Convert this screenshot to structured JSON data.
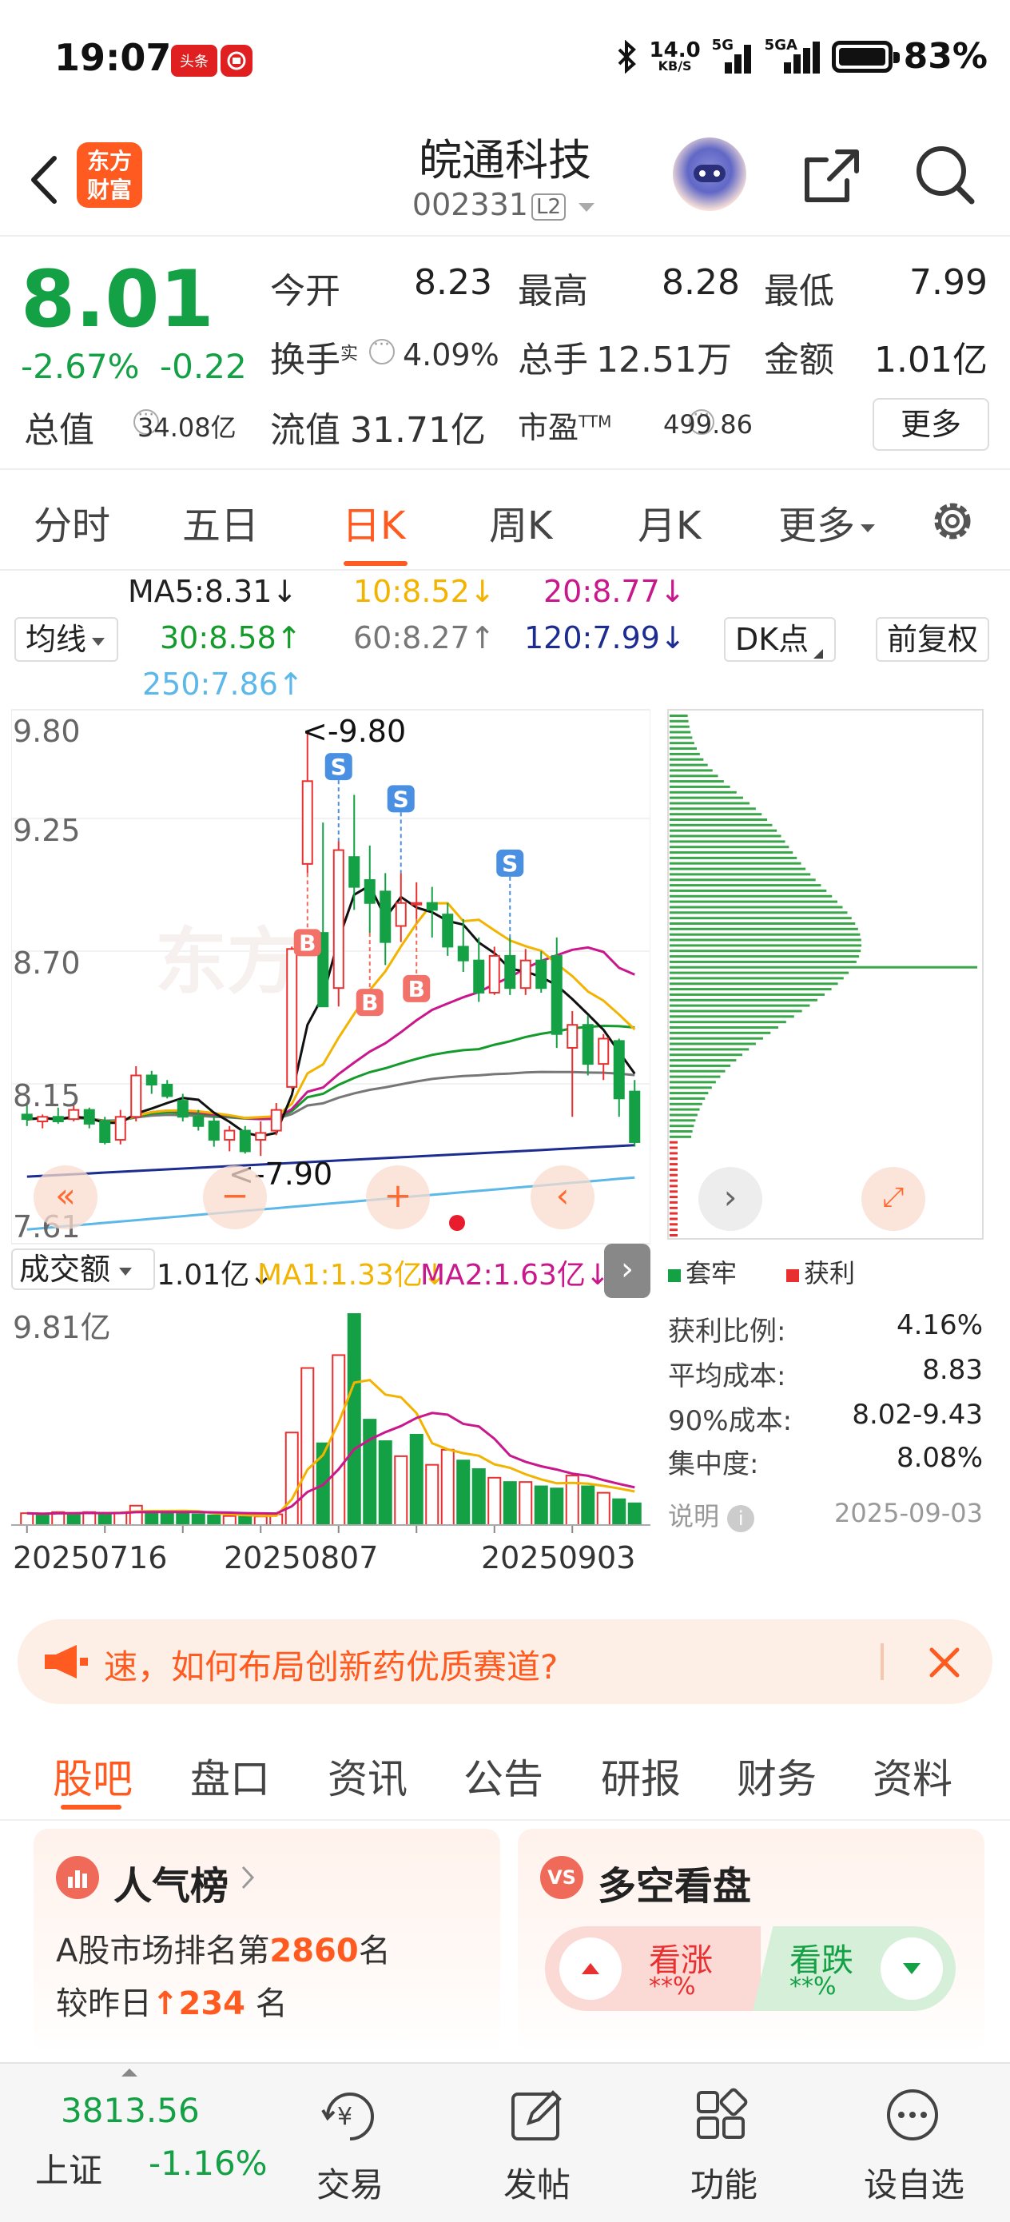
{
  "status_bar": {
    "time": "19:07",
    "badge1": "头条",
    "netspeed_value": "14.0",
    "netspeed_unit": "KB/S",
    "net1": "5G",
    "net2": "5GA",
    "battery": "83%"
  },
  "header": {
    "brand_line1": "东方",
    "brand_line2": "财富",
    "stock_name": "皖通科技",
    "stock_code": "002331",
    "level_badge": "L2"
  },
  "quote": {
    "last_price": "8.01",
    "change_pct": "-2.67%",
    "change_amt": "-0.22",
    "open_label": "今开",
    "open_value": "8.23",
    "high_label": "最高",
    "high_value": "8.28",
    "low_label": "最低",
    "low_value": "7.99",
    "turnover_label": "换手",
    "turnover_sup": "实",
    "turnover_value": "4.09%",
    "volume_label": "总手",
    "volume_value": "12.51万",
    "amount_label": "金额",
    "amount_value": "1.01亿",
    "mktcap_label": "总值",
    "mktcap_value": "34.08亿",
    "float_label": "流值",
    "float_value": "31.71亿",
    "pe_label": "市盈",
    "pe_sup": "TTM",
    "pe_value": "499.86",
    "more_label": "更多"
  },
  "period_tabs": [
    "分时",
    "五日",
    "日K",
    "周K",
    "月K",
    "更多"
  ],
  "ma_legend": {
    "ma5": "MA5:8.31↓",
    "ma10": "10:8.52↓",
    "ma20": "20:8.77↓",
    "ma30": "30:8.58↑",
    "ma60": "60:8.27↑",
    "ma120": "120:7.99↓",
    "ma250": "250:7.86↑",
    "junxian": "均线",
    "dk_point": "DK点",
    "fuquan": "前复权"
  },
  "colors": {
    "up": "#e93030",
    "down": "#14a044",
    "ma5": "#111111",
    "ma10": "#f2b400",
    "ma20": "#c8188c",
    "ma30": "#149b2c",
    "ma60": "#777777",
    "ma120": "#1c2c90",
    "ma250": "#5bb8e8",
    "accent": "#ff5a1f"
  },
  "chart_data": [
    {
      "type": "candlestick",
      "y_ticks": [
        "9.80",
        "9.25",
        "8.70",
        "8.15",
        "7.61"
      ],
      "ylim": [
        7.61,
        9.8
      ],
      "max_marker": "<-9.80",
      "min_marker": "<-7.90",
      "signals": [
        {
          "label": "S",
          "type": "sell",
          "index": 20
        },
        {
          "label": "S",
          "type": "sell",
          "index": 24
        },
        {
          "label": "S",
          "type": "sell",
          "index": 31
        },
        {
          "label": "B",
          "type": "buy",
          "index": 18
        },
        {
          "label": "B",
          "type": "buy",
          "index": 22
        },
        {
          "label": "B",
          "type": "buy",
          "index": 25
        }
      ],
      "candles": [
        {
          "o": 8.13,
          "h": 8.17,
          "l": 8.08,
          "c": 8.11
        },
        {
          "o": 8.1,
          "h": 8.13,
          "l": 8.07,
          "c": 8.12
        },
        {
          "o": 8.12,
          "h": 8.16,
          "l": 8.09,
          "c": 8.1
        },
        {
          "o": 8.11,
          "h": 8.17,
          "l": 8.1,
          "c": 8.15
        },
        {
          "o": 8.15,
          "h": 8.16,
          "l": 8.07,
          "c": 8.09
        },
        {
          "o": 8.1,
          "h": 8.12,
          "l": 8.0,
          "c": 8.01
        },
        {
          "o": 8.02,
          "h": 8.15,
          "l": 8.0,
          "c": 8.12
        },
        {
          "o": 8.12,
          "h": 8.34,
          "l": 8.1,
          "c": 8.3
        },
        {
          "o": 8.3,
          "h": 8.32,
          "l": 8.22,
          "c": 8.26
        },
        {
          "o": 8.26,
          "h": 8.28,
          "l": 8.2,
          "c": 8.21
        },
        {
          "o": 8.19,
          "h": 8.22,
          "l": 8.1,
          "c": 8.12
        },
        {
          "o": 8.12,
          "h": 8.15,
          "l": 8.06,
          "c": 8.08
        },
        {
          "o": 8.1,
          "h": 8.12,
          "l": 7.99,
          "c": 8.02
        },
        {
          "o": 8.02,
          "h": 8.08,
          "l": 7.97,
          "c": 8.06
        },
        {
          "o": 8.06,
          "h": 8.08,
          "l": 7.96,
          "c": 7.97
        },
        {
          "o": 8.02,
          "h": 8.1,
          "l": 7.95,
          "c": 8.05
        },
        {
          "o": 8.06,
          "h": 8.18,
          "l": 8.04,
          "c": 8.15
        },
        {
          "o": 8.25,
          "h": 8.86,
          "l": 8.24,
          "c": 8.85
        },
        {
          "o": 9.22,
          "h": 9.8,
          "l": 9.18,
          "c": 9.58
        },
        {
          "o": 8.92,
          "h": 9.4,
          "l": 8.7,
          "c": 8.6
        },
        {
          "o": 8.68,
          "h": 9.32,
          "l": 8.6,
          "c": 9.28
        },
        {
          "o": 9.25,
          "h": 9.52,
          "l": 9.02,
          "c": 9.12
        },
        {
          "o": 9.15,
          "h": 9.3,
          "l": 8.92,
          "c": 9.05
        },
        {
          "o": 9.1,
          "h": 9.18,
          "l": 8.78,
          "c": 8.88
        },
        {
          "o": 8.95,
          "h": 9.18,
          "l": 8.88,
          "c": 9.05
        },
        {
          "o": 9.05,
          "h": 9.14,
          "l": 8.98,
          "c": 9.05
        },
        {
          "o": 9.05,
          "h": 9.12,
          "l": 8.9,
          "c": 9.02
        },
        {
          "o": 9.0,
          "h": 9.05,
          "l": 8.82,
          "c": 8.86
        },
        {
          "o": 8.86,
          "h": 8.98,
          "l": 8.75,
          "c": 8.8
        },
        {
          "o": 8.8,
          "h": 8.9,
          "l": 8.62,
          "c": 8.66
        },
        {
          "o": 8.66,
          "h": 8.86,
          "l": 8.65,
          "c": 8.82
        },
        {
          "o": 8.82,
          "h": 8.9,
          "l": 8.65,
          "c": 8.68
        },
        {
          "o": 8.68,
          "h": 8.85,
          "l": 8.65,
          "c": 8.8
        },
        {
          "o": 8.8,
          "h": 8.84,
          "l": 8.66,
          "c": 8.68
        },
        {
          "o": 8.82,
          "h": 8.9,
          "l": 8.42,
          "c": 8.48
        },
        {
          "o": 8.42,
          "h": 8.58,
          "l": 8.12,
          "c": 8.52
        },
        {
          "o": 8.52,
          "h": 8.56,
          "l": 8.3,
          "c": 8.35
        },
        {
          "o": 8.35,
          "h": 8.48,
          "l": 8.28,
          "c": 8.46
        },
        {
          "o": 8.45,
          "h": 8.46,
          "l": 8.12,
          "c": 8.2
        },
        {
          "o": 8.23,
          "h": 8.28,
          "l": 7.99,
          "c": 8.01
        }
      ]
    },
    {
      "type": "bar",
      "title": "成交额",
      "series_name": "成交额",
      "value_label": "1.01亿↓",
      "ma1_label": "MA1:1.33亿↓",
      "ma2_label": "MA2:1.63亿↓",
      "y_max_label": "9.81亿",
      "x_labels": [
        "20250716",
        "20250807",
        "20250903"
      ],
      "values": [
        0.55,
        0.5,
        0.6,
        0.55,
        0.6,
        0.52,
        0.58,
        0.9,
        0.65,
        0.6,
        0.55,
        0.5,
        0.45,
        0.42,
        0.38,
        0.4,
        0.5,
        4.3,
        7.3,
        3.8,
        7.9,
        9.81,
        4.9,
        3.9,
        3.2,
        4.2,
        2.8,
        3.5,
        3.0,
        2.6,
        2.2,
        2.0,
        2.0,
        1.8,
        1.7,
        2.3,
        1.8,
        1.5,
        1.2,
        1.01
      ],
      "up": [
        true,
        false,
        true,
        false,
        true,
        false,
        true,
        true,
        false,
        false,
        false,
        false,
        false,
        true,
        false,
        true,
        true,
        true,
        true,
        false,
        true,
        false,
        false,
        false,
        true,
        false,
        true,
        true,
        false,
        false,
        true,
        false,
        true,
        false,
        false,
        true,
        false,
        true,
        false,
        false
      ]
    },
    {
      "type": "bar",
      "title": "筹码分布",
      "legend": [
        "套牢",
        "获利"
      ]
    }
  ],
  "chip_stats": {
    "legend_loss": "套牢",
    "legend_profit": "获利",
    "profit_ratio_label": "获利比例:",
    "profit_ratio_value": "4.16%",
    "avg_cost_label": "平均成本:",
    "avg_cost_value": "8.83",
    "cost90_label": "90%成本:",
    "cost90_value": "8.02-9.43",
    "concentration_label": "集中度:",
    "concentration_value": "8.08%",
    "note_label": "说明",
    "date": "2025-09-03"
  },
  "ad": {
    "text": "速，如何布局创新药优质赛道?"
  },
  "section_tabs": [
    "股吧",
    "盘口",
    "资讯",
    "公告",
    "研报",
    "财务",
    "资料"
  ],
  "popularity_card": {
    "title": "人气榜",
    "line1_prefix": "A股市场排名第",
    "rank": "2860",
    "line1_suffix": "名",
    "line2_prefix": "较昨日",
    "change": "234",
    "line2_suffix": "名"
  },
  "sentiment_card": {
    "badge": "VS",
    "title": "多空看盘",
    "bull_label": "看涨",
    "bull_value": "**%",
    "bear_label": "看跌",
    "bear_value": "**%"
  },
  "bottom_nav": {
    "index_value": "3813.56",
    "index_name": "上证",
    "index_change": "-1.16%",
    "trade": "交易",
    "post": "发帖",
    "features": "功能",
    "watchlist": "设自选"
  }
}
